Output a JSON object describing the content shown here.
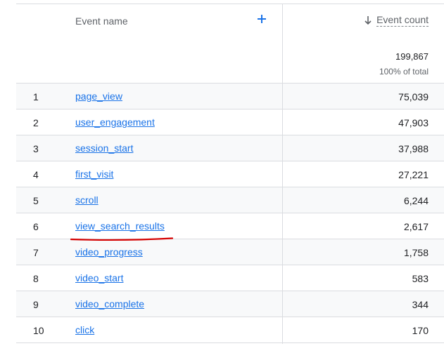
{
  "header": {
    "event_name_label": "Event name",
    "event_count_label": "Event count",
    "total": "199,867",
    "percent_of_total": "100% of total"
  },
  "rows": [
    {
      "rank": "1",
      "name": "page_view",
      "count": "75,039"
    },
    {
      "rank": "2",
      "name": "user_engagement",
      "count": "47,903"
    },
    {
      "rank": "3",
      "name": "session_start",
      "count": "37,988"
    },
    {
      "rank": "4",
      "name": "first_visit",
      "count": "27,221"
    },
    {
      "rank": "5",
      "name": "scroll",
      "count": "6,244"
    },
    {
      "rank": "6",
      "name": "view_search_results",
      "count": "2,617"
    },
    {
      "rank": "7",
      "name": "video_progress",
      "count": "1,758"
    },
    {
      "rank": "8",
      "name": "video_start",
      "count": "583"
    },
    {
      "rank": "9",
      "name": "video_complete",
      "count": "344"
    },
    {
      "rank": "10",
      "name": "click",
      "count": "170"
    }
  ],
  "colors": {
    "link": "#1a73e8",
    "annotation": "#d50000"
  },
  "icons": {
    "add": "plus-icon",
    "sort": "arrow-down-icon"
  }
}
